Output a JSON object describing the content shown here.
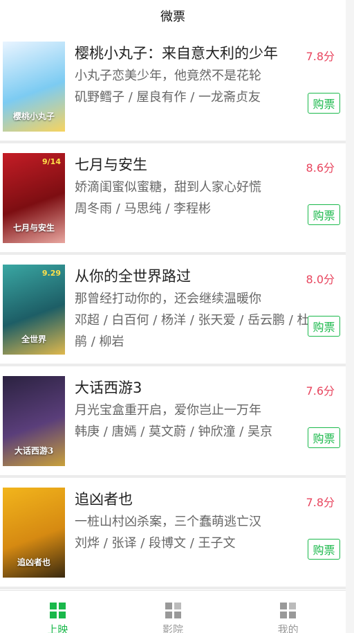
{
  "header": {
    "title": "微票"
  },
  "movies": [
    {
      "title": "樱桃小丸子：来自意大利的少年",
      "description": "小丸子恋美少年，他竟然不是花轮",
      "cast": "矶野鳕子 / 屋良有作 / 一龙斋贞友",
      "score": "7.8分",
      "buy_label": "购票"
    },
    {
      "title": "七月与安生",
      "description": "娇滴闺蜜似蜜糖，甜到人家心好慌",
      "cast": "周冬雨 / 马思纯 / 李程彬",
      "score": "8.6分",
      "buy_label": "购票"
    },
    {
      "title": "从你的全世界路过",
      "description": "那曾经打动你的，还会继续温暖你",
      "cast": "邓超 / 白百何 / 杨洋 / 张天爱 / 岳云鹏 / 杜鹃 / 柳岩",
      "score": "8.0分",
      "buy_label": "购票"
    },
    {
      "title": "大话西游3",
      "description": "月光宝盒重开启，爱你岂止一万年",
      "cast": "韩庚 / 唐嫣 / 莫文蔚 / 钟欣潼 / 吴京",
      "score": "7.6分",
      "buy_label": "购票"
    },
    {
      "title": "追凶者也",
      "description": "一桩山村凶杀案，三个蠢萌逃亡汉",
      "cast": "刘烨 / 张译 / 段博文 / 王子文",
      "score": "7.8分",
      "buy_label": "购票"
    }
  ],
  "posters": [
    {
      "text": "樱桃小丸子",
      "date": "",
      "colors": [
        "#e9f4ff",
        "#7ccbf2",
        "#f7d35e"
      ]
    },
    {
      "text": "七月与安生",
      "date": "9/14",
      "colors": [
        "#c41d26",
        "#7d0e12",
        "#e8a7a0"
      ]
    },
    {
      "text": "全世界",
      "date": "9.29",
      "colors": [
        "#3aa7a3",
        "#1d5e66",
        "#e0b84d"
      ]
    },
    {
      "text": "大话西游3",
      "date": "",
      "colors": [
        "#2b2240",
        "#5a3e7a",
        "#c9a13b"
      ]
    },
    {
      "text": "追凶者也",
      "date": "",
      "colors": [
        "#f2b51c",
        "#d68a12",
        "#3a2a10"
      ]
    }
  ],
  "tabs": [
    {
      "label": "上映",
      "active": true,
      "icon": "grid-icon"
    },
    {
      "label": "影院",
      "active": false,
      "icon": "grid-icon"
    },
    {
      "label": "我的",
      "active": false,
      "icon": "grid-icon"
    }
  ],
  "colors": {
    "accent": "#19b84a",
    "score": "#e8455e",
    "tab_inactive": "#999999"
  }
}
